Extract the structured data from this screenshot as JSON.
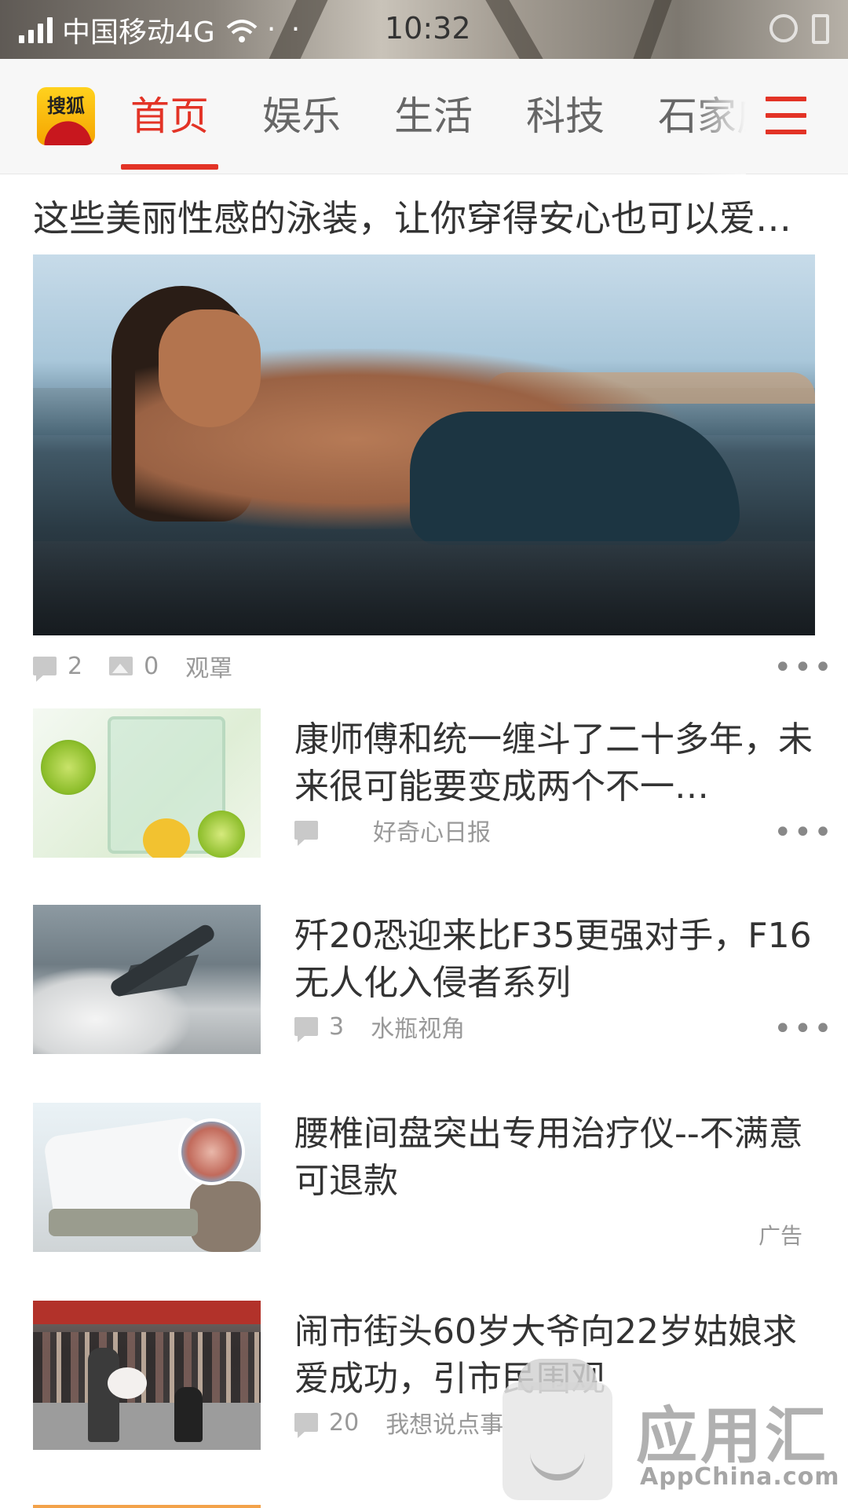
{
  "status_bar": {
    "carrier": "中国移动4G",
    "extra": "· ·",
    "time": "10:32"
  },
  "nav": {
    "logo_text": "搜狐",
    "tabs": [
      {
        "label": "首页",
        "active": true
      },
      {
        "label": "娱乐",
        "active": false
      },
      {
        "label": "生活",
        "active": false
      },
      {
        "label": "科技",
        "active": false
      },
      {
        "label": "石家庄",
        "active": false
      }
    ],
    "menu_icon": "hamburger-menu-icon",
    "accent_color": "#e33326"
  },
  "feed": {
    "featured": {
      "title": "这些美丽性感的泳装，让你穿得安心也可以爱…",
      "comments": "2",
      "images": "0",
      "source": "观罩"
    },
    "items": [
      {
        "title": "康师傅和统一缠斗了二十多年，未来很可能要变成两个不一…",
        "comments": "",
        "source": "好奇心日报",
        "ad": ""
      },
      {
        "title": "歼20恐迎来比F35更强对手，F16无人化入侵者系列",
        "comments": "3",
        "source": "水瓶视角",
        "ad": ""
      },
      {
        "title": "腰椎间盘突出专用治疗仪--不满意可退款",
        "comments": "",
        "source": "",
        "ad": "广告"
      },
      {
        "title": "闹市街头60岁大爷向22岁姑娘求爱成功，引市民围观",
        "comments": "20",
        "source": "我想说点事",
        "ad": ""
      }
    ],
    "more_glyph": "•••"
  },
  "watermark": {
    "text": "应用汇",
    "sub": "AppChina.com"
  }
}
